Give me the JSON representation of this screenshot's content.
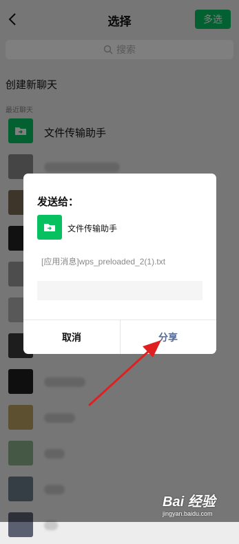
{
  "header": {
    "title": "选择",
    "multi_select_label": "多选"
  },
  "search": {
    "placeholder": "搜索"
  },
  "new_chat_label": "创建新聊天",
  "recent_label": "最近聊天",
  "chats": [
    {
      "name": "文件传输助手",
      "avatar": "file-transfer-icon"
    }
  ],
  "dialog": {
    "title": "发送给：",
    "recipient": "文件传输助手",
    "file_message": "[应用消息]wps_preloaded_2(1).txt",
    "cancel_label": "取消",
    "share_label": "分享"
  },
  "watermark": {
    "logo": "Bai 经验",
    "url": "jingyan.baidu.com"
  },
  "colors": {
    "accent": "#07c160",
    "link": "#576b95",
    "annotation_arrow": "#e02020"
  }
}
